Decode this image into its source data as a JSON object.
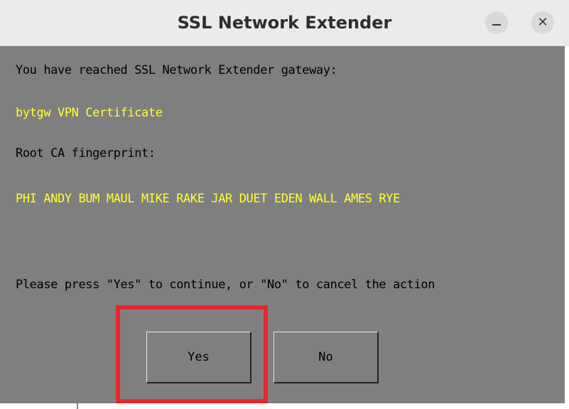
{
  "window": {
    "title": "SSL Network Extender",
    "minimize_icon": "minimize-icon",
    "close_icon": "close-icon",
    "close_glyph": "✕"
  },
  "dialog": {
    "line1": "You have reached SSL Network Extender gateway:",
    "gateway_name": "bytgw VPN Certificate",
    "fingerprint_label": "Root CA fingerprint:",
    "fingerprint": "PHI ANDY BUM MAUL MIKE RAKE JAR DUET EDEN WALL AMES RYE",
    "prompt": "Please press \"Yes\" to continue, or \"No\" to cancel the action"
  },
  "buttons": {
    "yes_label": "Yes",
    "no_label": "No"
  },
  "colors": {
    "background": "#7f7f7f",
    "highlight_text": "#ffff33",
    "annotation_box": "#e8262a"
  }
}
